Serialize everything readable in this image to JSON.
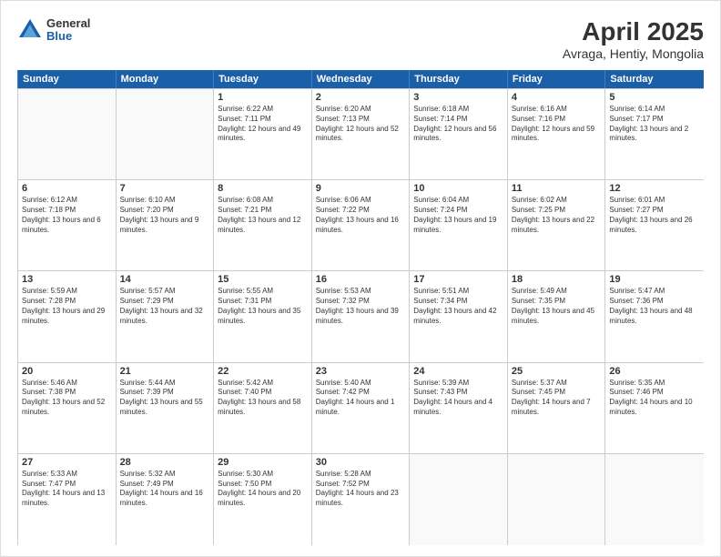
{
  "header": {
    "logo": {
      "general": "General",
      "blue": "Blue"
    },
    "title": "April 2025",
    "subtitle": "Avraga, Hentiy, Mongolia"
  },
  "days_of_week": [
    "Sunday",
    "Monday",
    "Tuesday",
    "Wednesday",
    "Thursday",
    "Friday",
    "Saturday"
  ],
  "weeks": [
    [
      {
        "day": "",
        "empty": true
      },
      {
        "day": "",
        "empty": true
      },
      {
        "day": "1",
        "sunrise": "6:22 AM",
        "sunset": "7:11 PM",
        "daylight": "12 hours and 49 minutes."
      },
      {
        "day": "2",
        "sunrise": "6:20 AM",
        "sunset": "7:13 PM",
        "daylight": "12 hours and 52 minutes."
      },
      {
        "day": "3",
        "sunrise": "6:18 AM",
        "sunset": "7:14 PM",
        "daylight": "12 hours and 56 minutes."
      },
      {
        "day": "4",
        "sunrise": "6:16 AM",
        "sunset": "7:16 PM",
        "daylight": "12 hours and 59 minutes."
      },
      {
        "day": "5",
        "sunrise": "6:14 AM",
        "sunset": "7:17 PM",
        "daylight": "13 hours and 2 minutes."
      }
    ],
    [
      {
        "day": "6",
        "sunrise": "6:12 AM",
        "sunset": "7:18 PM",
        "daylight": "13 hours and 6 minutes."
      },
      {
        "day": "7",
        "sunrise": "6:10 AM",
        "sunset": "7:20 PM",
        "daylight": "13 hours and 9 minutes."
      },
      {
        "day": "8",
        "sunrise": "6:08 AM",
        "sunset": "7:21 PM",
        "daylight": "13 hours and 12 minutes."
      },
      {
        "day": "9",
        "sunrise": "6:06 AM",
        "sunset": "7:22 PM",
        "daylight": "13 hours and 16 minutes."
      },
      {
        "day": "10",
        "sunrise": "6:04 AM",
        "sunset": "7:24 PM",
        "daylight": "13 hours and 19 minutes."
      },
      {
        "day": "11",
        "sunrise": "6:02 AM",
        "sunset": "7:25 PM",
        "daylight": "13 hours and 22 minutes."
      },
      {
        "day": "12",
        "sunrise": "6:01 AM",
        "sunset": "7:27 PM",
        "daylight": "13 hours and 26 minutes."
      }
    ],
    [
      {
        "day": "13",
        "sunrise": "5:59 AM",
        "sunset": "7:28 PM",
        "daylight": "13 hours and 29 minutes."
      },
      {
        "day": "14",
        "sunrise": "5:57 AM",
        "sunset": "7:29 PM",
        "daylight": "13 hours and 32 minutes."
      },
      {
        "day": "15",
        "sunrise": "5:55 AM",
        "sunset": "7:31 PM",
        "daylight": "13 hours and 35 minutes."
      },
      {
        "day": "16",
        "sunrise": "5:53 AM",
        "sunset": "7:32 PM",
        "daylight": "13 hours and 39 minutes."
      },
      {
        "day": "17",
        "sunrise": "5:51 AM",
        "sunset": "7:34 PM",
        "daylight": "13 hours and 42 minutes."
      },
      {
        "day": "18",
        "sunrise": "5:49 AM",
        "sunset": "7:35 PM",
        "daylight": "13 hours and 45 minutes."
      },
      {
        "day": "19",
        "sunrise": "5:47 AM",
        "sunset": "7:36 PM",
        "daylight": "13 hours and 48 minutes."
      }
    ],
    [
      {
        "day": "20",
        "sunrise": "5:46 AM",
        "sunset": "7:38 PM",
        "daylight": "13 hours and 52 minutes."
      },
      {
        "day": "21",
        "sunrise": "5:44 AM",
        "sunset": "7:39 PM",
        "daylight": "13 hours and 55 minutes."
      },
      {
        "day": "22",
        "sunrise": "5:42 AM",
        "sunset": "7:40 PM",
        "daylight": "13 hours and 58 minutes."
      },
      {
        "day": "23",
        "sunrise": "5:40 AM",
        "sunset": "7:42 PM",
        "daylight": "14 hours and 1 minute."
      },
      {
        "day": "24",
        "sunrise": "5:39 AM",
        "sunset": "7:43 PM",
        "daylight": "14 hours and 4 minutes."
      },
      {
        "day": "25",
        "sunrise": "5:37 AM",
        "sunset": "7:45 PM",
        "daylight": "14 hours and 7 minutes."
      },
      {
        "day": "26",
        "sunrise": "5:35 AM",
        "sunset": "7:46 PM",
        "daylight": "14 hours and 10 minutes."
      }
    ],
    [
      {
        "day": "27",
        "sunrise": "5:33 AM",
        "sunset": "7:47 PM",
        "daylight": "14 hours and 13 minutes."
      },
      {
        "day": "28",
        "sunrise": "5:32 AM",
        "sunset": "7:49 PM",
        "daylight": "14 hours and 16 minutes."
      },
      {
        "day": "29",
        "sunrise": "5:30 AM",
        "sunset": "7:50 PM",
        "daylight": "14 hours and 20 minutes."
      },
      {
        "day": "30",
        "sunrise": "5:28 AM",
        "sunset": "7:52 PM",
        "daylight": "14 hours and 23 minutes."
      },
      {
        "day": "",
        "empty": true
      },
      {
        "day": "",
        "empty": true
      },
      {
        "day": "",
        "empty": true
      }
    ]
  ]
}
